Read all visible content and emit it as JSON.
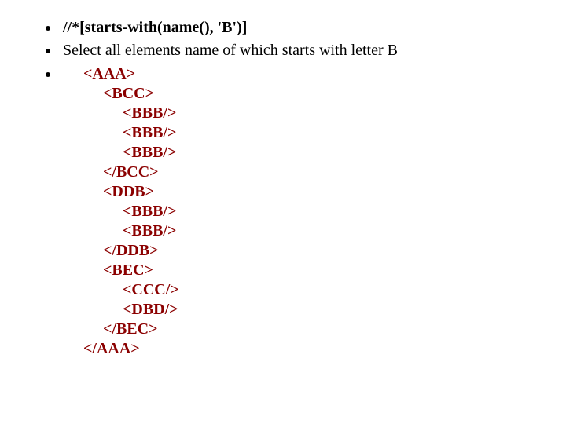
{
  "bullets": {
    "xpath": "//*[starts-with(name(), 'B')]",
    "description": "Select all elements name of which starts with letter B"
  },
  "code": "<AAA>\n     <BCC>\n          <BBB/>\n          <BBB/>\n          <BBB/>\n     </BCC>\n     <DDB>\n          <BBB/>\n          <BBB/>\n     </DDB>\n     <BEC>\n          <CCC/>\n          <DBD/>\n     </BEC>\n</AAA>"
}
